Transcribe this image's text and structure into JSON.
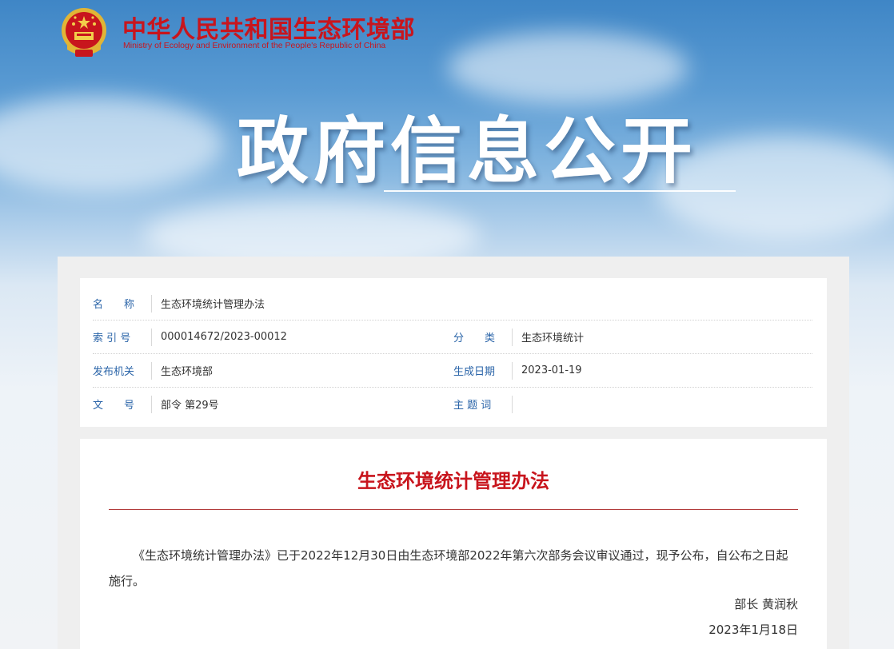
{
  "header": {
    "ministry_cn": "中华人民共和国生态环境部",
    "ministry_en": "Ministry of Ecology and Environment of the People's Republic of China",
    "banner_title": "政府信息公开"
  },
  "meta": {
    "name_label": "名　　称",
    "name_value": "生态环境统计管理办法",
    "index_label": "索 引 号",
    "index_value": "000014672/2023-00012",
    "category_label": "分　　类",
    "category_value": "生态环境统计",
    "issuer_label": "发布机关",
    "issuer_value": "生态环境部",
    "date_label": "生成日期",
    "date_value": "2023-01-19",
    "docno_label": "文　　号",
    "docno_value": "部令 第29号",
    "topic_label": "主 题 词",
    "topic_value": ""
  },
  "document": {
    "title": "生态环境统计管理办法",
    "body": "《生态环境统计管理办法》已于2022年12月30日由生态环境部2022年第六次部务会议审议通过，现予公布，自公布之日起施行。",
    "signature": "部长  黄润秋",
    "date": "2023年1月18日"
  },
  "colors": {
    "brand_red": "#c8151d",
    "label_blue": "#2a64a8"
  },
  "icons": {
    "emblem": "national-emblem-icon"
  }
}
